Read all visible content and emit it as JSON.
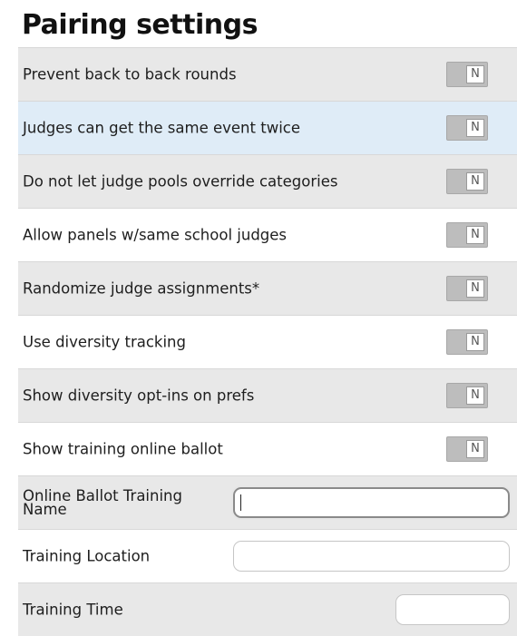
{
  "page": {
    "title": "Pairing settings"
  },
  "toggles": [
    {
      "label": "Prevent back to back rounds",
      "value": "N"
    },
    {
      "label": "Judges can get the same event twice",
      "value": "N"
    },
    {
      "label": "Do not let judge pools override categories",
      "value": "N"
    },
    {
      "label": "Allow panels w/same school judges",
      "value": "N"
    },
    {
      "label": "Randomize judge assignments*",
      "value": "N"
    },
    {
      "label": "Use diversity tracking",
      "value": "N"
    },
    {
      "label": "Show diversity opt-ins on prefs",
      "value": "N"
    },
    {
      "label": "Show training online ballot",
      "value": "N"
    }
  ],
  "fields": [
    {
      "label": "Online Ballot Training Name",
      "value": "",
      "placeholder": ""
    },
    {
      "label": "Training Location",
      "value": "",
      "placeholder": ""
    },
    {
      "label": "Training Time",
      "value": "",
      "placeholder": ""
    }
  ]
}
